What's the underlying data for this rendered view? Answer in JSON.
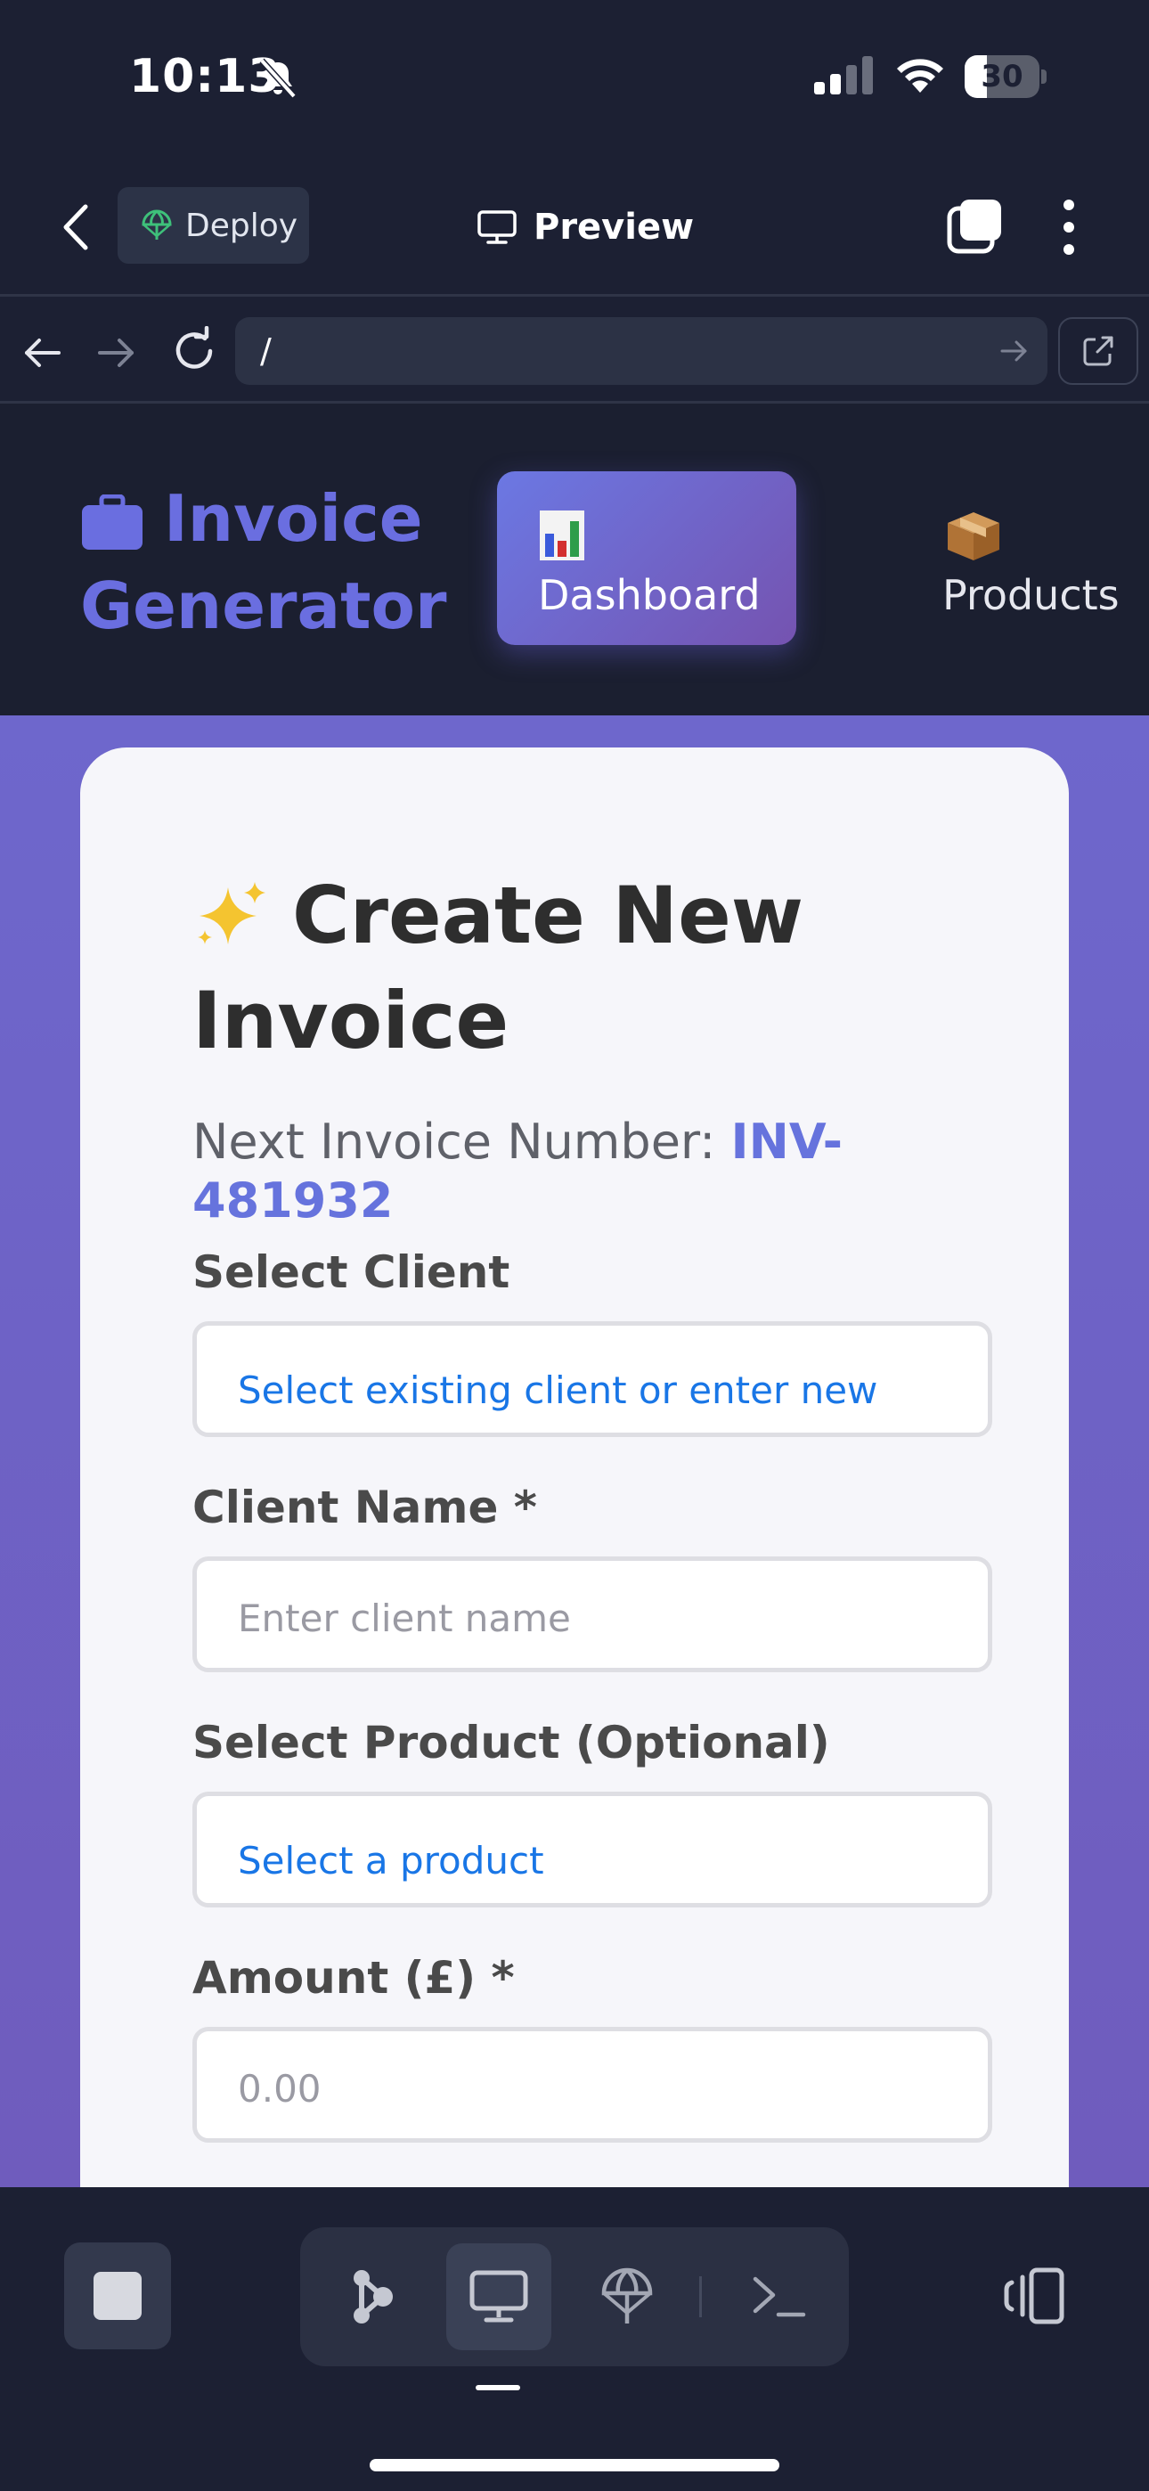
{
  "status_bar": {
    "time": "10:13",
    "battery_percent": "30",
    "battery_level": 0.3
  },
  "app_bar": {
    "deploy_label": "Deploy",
    "preview_label": "Preview"
  },
  "browser": {
    "url": "/"
  },
  "site": {
    "brand_line1": "Invoice",
    "brand_line2": "Generator",
    "nav": [
      {
        "label": "Dashboard",
        "icon": "bar-chart-icon",
        "active": true
      },
      {
        "label": "Products",
        "icon": "package-icon",
        "active": false
      }
    ]
  },
  "form": {
    "title": "Create New Invoice",
    "invoice_number_label": "Next Invoice Number:",
    "invoice_number_value": "INV-481932",
    "fields": {
      "client_select": {
        "label": "Select Client",
        "value": "Select existing client or enter new"
      },
      "client_name": {
        "label": "Client Name *",
        "placeholder": "Enter client name"
      },
      "product_select": {
        "label": "Select Product (Optional)",
        "value": "Select a product"
      },
      "amount": {
        "label": "Amount (£) *",
        "placeholder": "0.00"
      }
    }
  },
  "colors": {
    "accent": "#6673dd",
    "select_text": "#1976e6",
    "page_background": "#1c2033",
    "purple_background": "#6e67cc"
  }
}
